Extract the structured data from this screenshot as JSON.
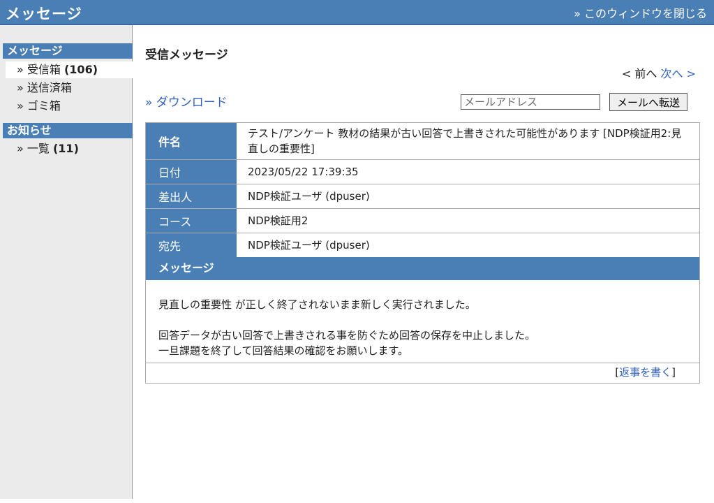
{
  "header": {
    "title": "メッセージ",
    "close_link": "» このウィンドウを閉じる"
  },
  "sidebar": {
    "sections": [
      {
        "heading": "メッセージ",
        "items": [
          {
            "label": "» 受信箱",
            "count": "(106)"
          },
          {
            "label": "» 送信済箱",
            "count": ""
          },
          {
            "label": "» ゴミ箱",
            "count": ""
          }
        ]
      },
      {
        "heading": "お知らせ",
        "items": [
          {
            "label": "» 一覧",
            "count": "(11)"
          }
        ]
      }
    ]
  },
  "main": {
    "title": "受信メッセージ",
    "pager": {
      "prev": "< 前へ",
      "next": "次へ >"
    },
    "download": "» ダウンロード",
    "forward": {
      "placeholder": "メールアドレス",
      "button": "メールへ転送"
    },
    "fields": [
      {
        "label": "件名",
        "value": "テスト/アンケート 教材の結果が古い回答で上書きされた可能性があります [NDP検証用2:見直しの重要性]"
      },
      {
        "label": "日付",
        "value": "2023/05/22 17:39:35"
      },
      {
        "label": "差出人",
        "value": "NDP検証ユーザ (dpuser)"
      },
      {
        "label": "コース",
        "value": "NDP検証用2"
      },
      {
        "label": "宛先",
        "value": "NDP検証ユーザ (dpuser)"
      }
    ],
    "message_heading": "メッセージ",
    "body_lines": [
      "見直しの重要性 が正しく終了されないまま新しく実行されました。",
      "回答データが古い回答で上書きされる事を防ぐため回答の保存を中止しました。",
      "一旦課題を終了して回答結果の確認をお願いします。"
    ],
    "reply": {
      "open": "[",
      "link": "返事を書く",
      "close": "]"
    }
  },
  "colors": {
    "accent": "#4a7fb5",
    "link": "#3060c0",
    "sidebar_bg": "#ebebeb"
  }
}
